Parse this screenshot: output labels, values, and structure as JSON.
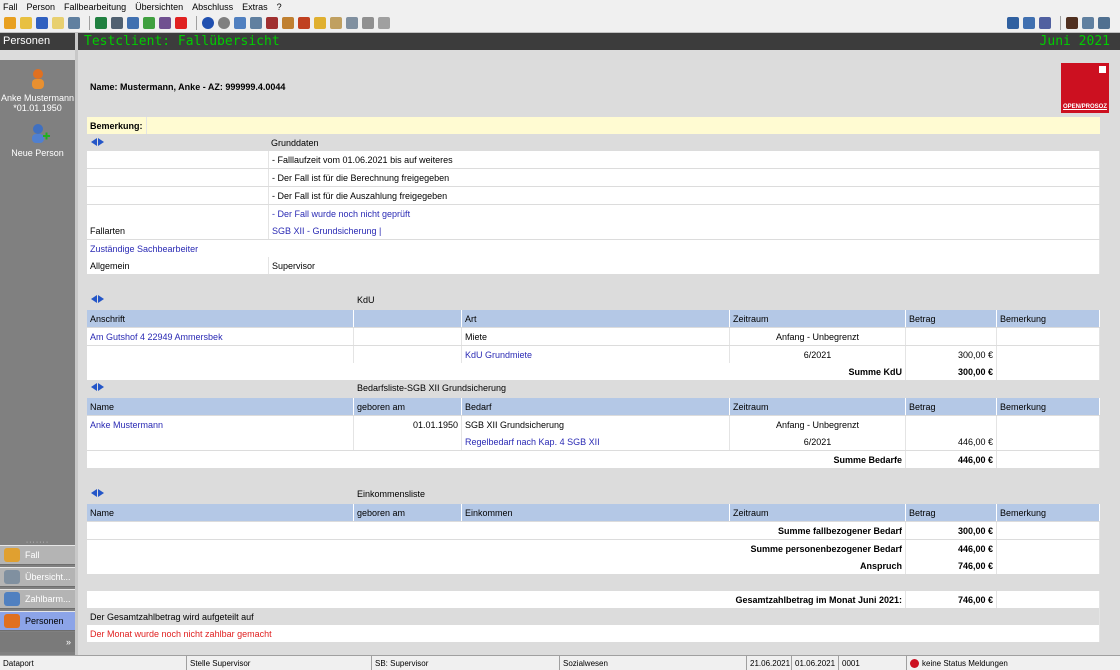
{
  "menu": [
    "Fall",
    "Person",
    "Fallbearbeitung",
    "Übersichten",
    "Abschluss",
    "Extras",
    "?"
  ],
  "sidebar": {
    "header": "Personen",
    "person_name": "Anke Mustermann",
    "person_dob": "*01.01.1950",
    "new_person": "Neue Person",
    "nav": [
      {
        "label": "Fall"
      },
      {
        "label": "Übersicht..."
      },
      {
        "label": "Zahlbarm..."
      },
      {
        "label": "Personen"
      }
    ],
    "more": "»"
  },
  "titlebar": {
    "title": "Testclient: Fallübersicht",
    "period": "Juni 2021"
  },
  "logo": {
    "text": "OPEN/PROSOZ"
  },
  "case": {
    "name": "Name: Mustermann, Anke - AZ: 999999.4.0044"
  },
  "remark": "Bemerkung:",
  "grunddaten": {
    "title": "Grunddaten",
    "lines": [
      "- Falllaufzeit vom 01.06.2021 bis auf weiteres",
      "- Der Fall ist für die Berechnung freigegeben",
      "- Der Fall ist für die Auszahlung freigegeben",
      "- Der Fall wurde noch nicht geprüft"
    ],
    "fallarten_label": "Fallarten",
    "fallarten_value": "SGB XII - Grundsicherung |",
    "sachbearbeiter": "Zuständige Sachbearbeiter",
    "allgemein_label": "Allgemein",
    "allgemein_value": "Supervisor"
  },
  "kdu": {
    "title": "KdU",
    "headers": [
      "Anschrift",
      "",
      "Art",
      "Zeitraum",
      "Betrag",
      "Bemerkung"
    ],
    "rows": [
      [
        "Am Gutshof 4 22949 Ammersbek",
        "",
        "Miete",
        "Anfang - Unbegrenzt",
        "",
        ""
      ],
      [
        "",
        "",
        "KdU Grundmiete",
        "6/2021",
        "300,00 €",
        ""
      ]
    ],
    "sum_label": "Summe KdU",
    "sum_value": "300,00 €"
  },
  "bedarf": {
    "title": "Bedarfsliste-SGB XII Grundsicherung",
    "headers": [
      "Name",
      "geboren am",
      "Bedarf",
      "Zeitraum",
      "Betrag",
      "Bemerkung"
    ],
    "rows": [
      [
        "Anke Mustermann",
        "01.01.1950",
        "SGB XII Grundsicherung",
        "Anfang - Unbegrenzt",
        "",
        ""
      ],
      [
        "",
        "",
        "Regelbedarf nach Kap. 4 SGB XII",
        "6/2021",
        "446,00 €",
        ""
      ]
    ],
    "sum_label": "Summe Bedarfe",
    "sum_value": "446,00 €"
  },
  "einkommen": {
    "title": "Einkommensliste",
    "headers": [
      "Name",
      "geboren am",
      "Einkommen",
      "Zeitraum",
      "Betrag",
      "Bemerkung"
    ]
  },
  "summary": [
    {
      "label": "Summe fallbezogener Bedarf",
      "value": "300,00 €"
    },
    {
      "label": "Summe personenbezogener Bedarf",
      "value": "446,00 €"
    },
    {
      "label": "Anspruch",
      "value": "746,00 €"
    }
  ],
  "gesamt": {
    "label": "Gesamtzahlbetrag im Monat Juni 2021:",
    "value": "746,00 €"
  },
  "aufteilung": "Der Gesamtzahlbetrag wird aufgeteilt auf",
  "warning": "Der Monat wurde noch nicht zahlbar gemacht",
  "status": {
    "app": "Dataport",
    "stelle": "Stelle Supervisor",
    "sb": "SB: Supervisor",
    "bereich": "Sozialwesen",
    "date1": "21.06.2021",
    "date2": "01.06.2021",
    "code": "0001",
    "messages": "keine Status Meldungen"
  },
  "colors": {
    "accent": "#00cc00",
    "header_blue": "#b4c8e6",
    "link": "#2a2ab4",
    "warning": "#e02020",
    "logo": "#cc1020"
  }
}
